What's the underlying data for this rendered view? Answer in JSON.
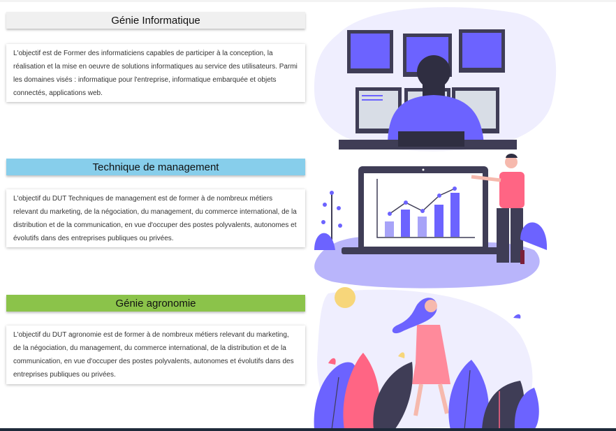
{
  "sections": [
    {
      "title": "Génie Informatique",
      "description": "L'objectif est de Former des informaticiens capables de participer à la conception, la réalisation et la mise en oeuvre de solutions informatiques au service des utilisateurs. Parmi les domaines visés : informatique pour l'entreprise, informatique embarquée et objets connectés, applications web."
    },
    {
      "title": "Technique de management",
      "description": "L'objectif du DUT Techniques de management est de former à de nombreux métiers relevant du marketing, de la négociation, du management, du commerce international, de la distribution et de la communication, en vue d'occuper des postes polyvalents, autonomes et évolutifs dans des entreprises publiques ou privées."
    },
    {
      "title": "Génie agronomie",
      "description": "L'objectif du DUT agronomie est de former à de nombreux métiers relevant du marketing, de la négociation, du management, du commerce international, de la distribution et de la communication, en vue d'occuper des postes polyvalents, autonomes et évolutifs dans des entreprises publiques ou privées."
    }
  ],
  "colors": {
    "accent": "#6c63ff",
    "title_informatique": "#f0f0f0",
    "title_management": "#87ceeb",
    "title_agronomie": "#8bc34a",
    "highlight": "#ff6584"
  }
}
